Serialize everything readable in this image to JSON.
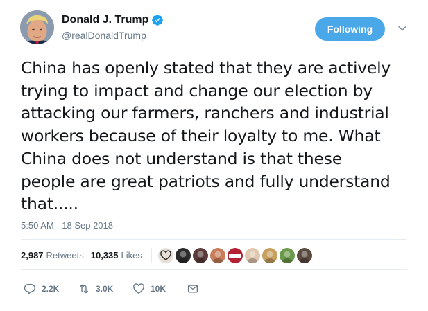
{
  "author": {
    "display_name": "Donald J. Trump",
    "handle": "@realDonaldTrump",
    "verified": true,
    "avatar_icon": "profile-photo"
  },
  "follow_button": {
    "label": "Following",
    "color": "#4aa8e8"
  },
  "tweet": {
    "text": "China has openly stated that they are actively\ntrying to impact and change our election by\nattacking our farmers, ranchers and industrial\nworkers because of their loyalty to me. What\nChina does not understand is that these\npeople are great patriots and fully understand\nthat.....",
    "timestamp": "5:50 AM - 18 Sep 2018"
  },
  "stats": {
    "retweets_count": "2,987",
    "retweets_label": "Retweets",
    "likes_count": "10,335",
    "likes_label": "Likes",
    "liker_avatars": [
      {
        "icon": "liker-avatar-heart",
        "color": "#e8e0d8"
      },
      {
        "icon": "liker-avatar-dark",
        "color": "#2b2b2b"
      },
      {
        "icon": "liker-avatar-emblem",
        "color": "#5a3a3a"
      },
      {
        "icon": "liker-avatar-woman",
        "color": "#c97c5a"
      },
      {
        "icon": "liker-avatar-red-banner",
        "color": "#b22234"
      },
      {
        "icon": "liker-avatar-flowers",
        "color": "#e0c8b0"
      },
      {
        "icon": "liker-avatar-animal",
        "color": "#c8a060"
      },
      {
        "icon": "liker-avatar-outdoor",
        "color": "#6a9a4a"
      },
      {
        "icon": "liker-avatar-person",
        "color": "#5a4a40"
      }
    ]
  },
  "actions": {
    "reply_count": "2.2K",
    "retweet_count": "3.0K",
    "like_count": "10K"
  },
  "colors": {
    "text": "#14171a",
    "secondary": "#657786",
    "divider": "#e6ecf0",
    "verified": "#1da1f2"
  }
}
